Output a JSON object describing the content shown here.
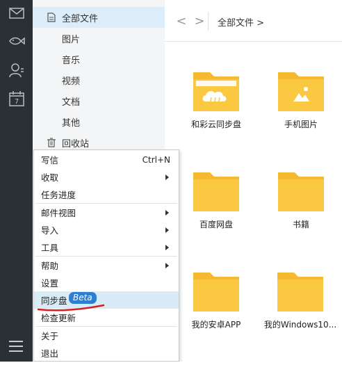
{
  "nav": {
    "all_files": "全部文件",
    "images": "图片",
    "music": "音乐",
    "video": "视频",
    "docs": "文档",
    "other": "其他",
    "recycle": "回收站"
  },
  "toolbar": {
    "back": "<",
    "forward": ">",
    "breadcrumb": "全部文件 >"
  },
  "folders": [
    {
      "label": "和彩云同步盘"
    },
    {
      "label": "手机图片"
    },
    {
      "label": "百度网盘"
    },
    {
      "label": "书籍"
    },
    {
      "label": "我的安卓APP"
    },
    {
      "label": "我的Windows10..."
    }
  ],
  "menu": {
    "compose": "写信",
    "compose_shortcut": "Ctrl+N",
    "receive": "收取",
    "task_progress": "任务进度",
    "mail_view": "邮件视图",
    "import": "导入",
    "tools": "工具",
    "help": "帮助",
    "settings": "设置",
    "sync_disk": "同步盘",
    "sync_badge": "Beta",
    "check_update": "检查更新",
    "about": "关于",
    "exit": "退出"
  },
  "colors": {
    "rail": "#2b3036",
    "accent": "#2f7fd0",
    "folder": "#fbc02d",
    "highlight": "#d9ebf7",
    "annotation": "#d61f1f"
  }
}
